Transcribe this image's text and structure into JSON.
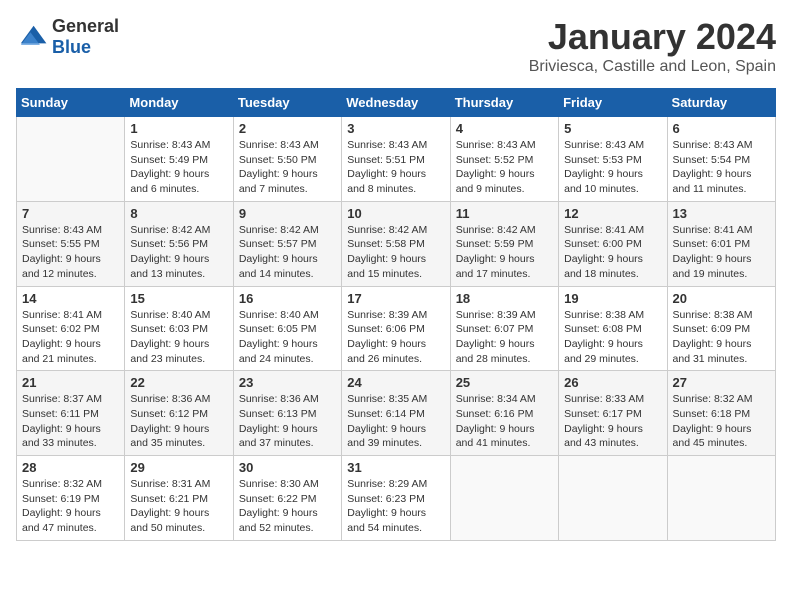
{
  "header": {
    "logo_general": "General",
    "logo_blue": "Blue",
    "month": "January 2024",
    "location": "Briviesca, Castille and Leon, Spain"
  },
  "weekdays": [
    "Sunday",
    "Monday",
    "Tuesday",
    "Wednesday",
    "Thursday",
    "Friday",
    "Saturday"
  ],
  "weeks": [
    [
      {
        "day": "",
        "info": ""
      },
      {
        "day": "1",
        "info": "Sunrise: 8:43 AM\nSunset: 5:49 PM\nDaylight: 9 hours\nand 6 minutes."
      },
      {
        "day": "2",
        "info": "Sunrise: 8:43 AM\nSunset: 5:50 PM\nDaylight: 9 hours\nand 7 minutes."
      },
      {
        "day": "3",
        "info": "Sunrise: 8:43 AM\nSunset: 5:51 PM\nDaylight: 9 hours\nand 8 minutes."
      },
      {
        "day": "4",
        "info": "Sunrise: 8:43 AM\nSunset: 5:52 PM\nDaylight: 9 hours\nand 9 minutes."
      },
      {
        "day": "5",
        "info": "Sunrise: 8:43 AM\nSunset: 5:53 PM\nDaylight: 9 hours\nand 10 minutes."
      },
      {
        "day": "6",
        "info": "Sunrise: 8:43 AM\nSunset: 5:54 PM\nDaylight: 9 hours\nand 11 minutes."
      }
    ],
    [
      {
        "day": "7",
        "info": "Sunrise: 8:43 AM\nSunset: 5:55 PM\nDaylight: 9 hours\nand 12 minutes."
      },
      {
        "day": "8",
        "info": "Sunrise: 8:42 AM\nSunset: 5:56 PM\nDaylight: 9 hours\nand 13 minutes."
      },
      {
        "day": "9",
        "info": "Sunrise: 8:42 AM\nSunset: 5:57 PM\nDaylight: 9 hours\nand 14 minutes."
      },
      {
        "day": "10",
        "info": "Sunrise: 8:42 AM\nSunset: 5:58 PM\nDaylight: 9 hours\nand 15 minutes."
      },
      {
        "day": "11",
        "info": "Sunrise: 8:42 AM\nSunset: 5:59 PM\nDaylight: 9 hours\nand 17 minutes."
      },
      {
        "day": "12",
        "info": "Sunrise: 8:41 AM\nSunset: 6:00 PM\nDaylight: 9 hours\nand 18 minutes."
      },
      {
        "day": "13",
        "info": "Sunrise: 8:41 AM\nSunset: 6:01 PM\nDaylight: 9 hours\nand 19 minutes."
      }
    ],
    [
      {
        "day": "14",
        "info": "Sunrise: 8:41 AM\nSunset: 6:02 PM\nDaylight: 9 hours\nand 21 minutes."
      },
      {
        "day": "15",
        "info": "Sunrise: 8:40 AM\nSunset: 6:03 PM\nDaylight: 9 hours\nand 23 minutes."
      },
      {
        "day": "16",
        "info": "Sunrise: 8:40 AM\nSunset: 6:05 PM\nDaylight: 9 hours\nand 24 minutes."
      },
      {
        "day": "17",
        "info": "Sunrise: 8:39 AM\nSunset: 6:06 PM\nDaylight: 9 hours\nand 26 minutes."
      },
      {
        "day": "18",
        "info": "Sunrise: 8:39 AM\nSunset: 6:07 PM\nDaylight: 9 hours\nand 28 minutes."
      },
      {
        "day": "19",
        "info": "Sunrise: 8:38 AM\nSunset: 6:08 PM\nDaylight: 9 hours\nand 29 minutes."
      },
      {
        "day": "20",
        "info": "Sunrise: 8:38 AM\nSunset: 6:09 PM\nDaylight: 9 hours\nand 31 minutes."
      }
    ],
    [
      {
        "day": "21",
        "info": "Sunrise: 8:37 AM\nSunset: 6:11 PM\nDaylight: 9 hours\nand 33 minutes."
      },
      {
        "day": "22",
        "info": "Sunrise: 8:36 AM\nSunset: 6:12 PM\nDaylight: 9 hours\nand 35 minutes."
      },
      {
        "day": "23",
        "info": "Sunrise: 8:36 AM\nSunset: 6:13 PM\nDaylight: 9 hours\nand 37 minutes."
      },
      {
        "day": "24",
        "info": "Sunrise: 8:35 AM\nSunset: 6:14 PM\nDaylight: 9 hours\nand 39 minutes."
      },
      {
        "day": "25",
        "info": "Sunrise: 8:34 AM\nSunset: 6:16 PM\nDaylight: 9 hours\nand 41 minutes."
      },
      {
        "day": "26",
        "info": "Sunrise: 8:33 AM\nSunset: 6:17 PM\nDaylight: 9 hours\nand 43 minutes."
      },
      {
        "day": "27",
        "info": "Sunrise: 8:32 AM\nSunset: 6:18 PM\nDaylight: 9 hours\nand 45 minutes."
      }
    ],
    [
      {
        "day": "28",
        "info": "Sunrise: 8:32 AM\nSunset: 6:19 PM\nDaylight: 9 hours\nand 47 minutes."
      },
      {
        "day": "29",
        "info": "Sunrise: 8:31 AM\nSunset: 6:21 PM\nDaylight: 9 hours\nand 50 minutes."
      },
      {
        "day": "30",
        "info": "Sunrise: 8:30 AM\nSunset: 6:22 PM\nDaylight: 9 hours\nand 52 minutes."
      },
      {
        "day": "31",
        "info": "Sunrise: 8:29 AM\nSunset: 6:23 PM\nDaylight: 9 hours\nand 54 minutes."
      },
      {
        "day": "",
        "info": ""
      },
      {
        "day": "",
        "info": ""
      },
      {
        "day": "",
        "info": ""
      }
    ]
  ]
}
